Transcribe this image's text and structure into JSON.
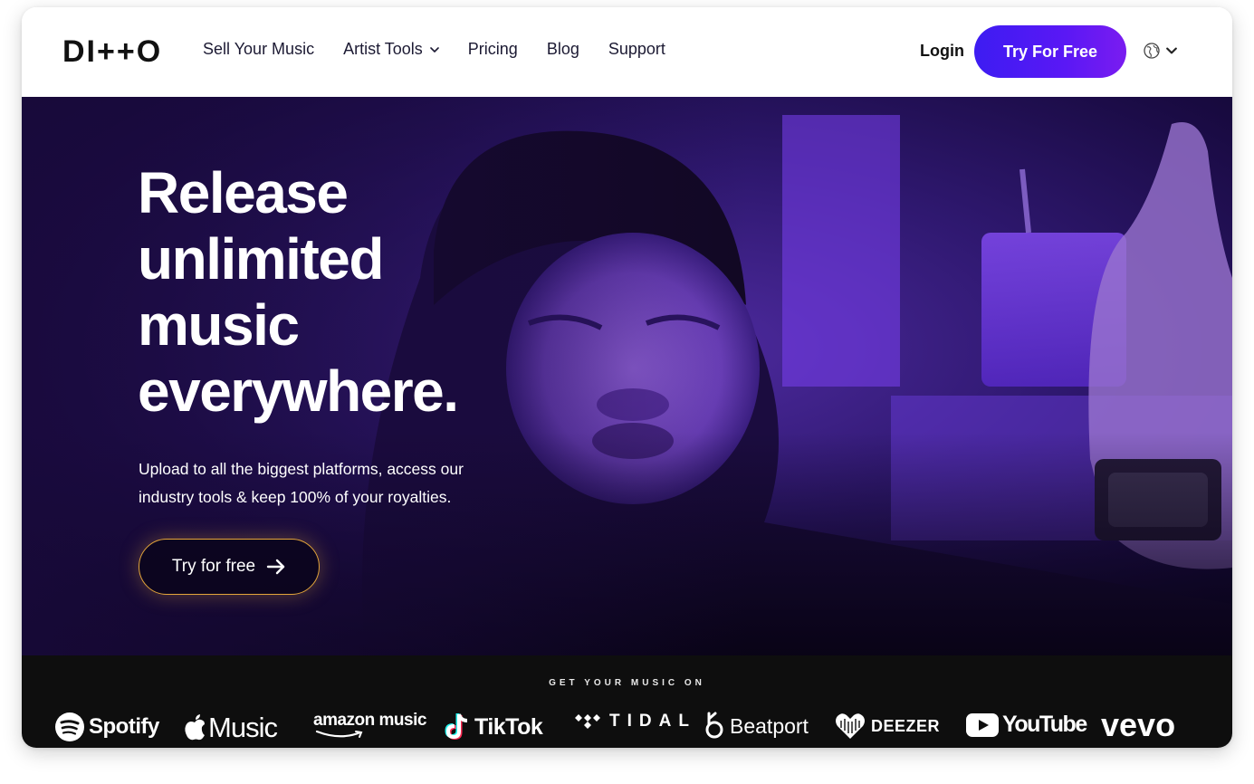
{
  "header": {
    "logo": "DI++O",
    "nav": [
      {
        "label": "Sell Your Music"
      },
      {
        "label": "Artist Tools",
        "has_dropdown": true
      },
      {
        "label": "Pricing"
      },
      {
        "label": "Blog"
      },
      {
        "label": "Support"
      }
    ],
    "login_label": "Login",
    "cta_label": "Try For Free",
    "language_icon": "globe-icon"
  },
  "hero": {
    "headline": [
      "Release",
      "unlimited",
      "music",
      "everywhere."
    ],
    "subtext": "Upload to all the biggest platforms, access our industry tools & keep 100% of your royalties.",
    "cta_label": "Try for free"
  },
  "platforms": {
    "title": "GET YOUR MUSIC ON",
    "logos": [
      "Spotify",
      "Music",
      "amazon music",
      "TikTok",
      "TIDAL",
      "Beatport",
      "DEEZER",
      "YouTube",
      "vevo"
    ]
  },
  "colors": {
    "accent_gradient_start": "#3d1cf2",
    "accent_gradient_end": "#7a1cf0",
    "hero_purple": "#4d2a9e",
    "cta_outline": "#e3a53a",
    "strip_bg": "#0e0e0e"
  }
}
